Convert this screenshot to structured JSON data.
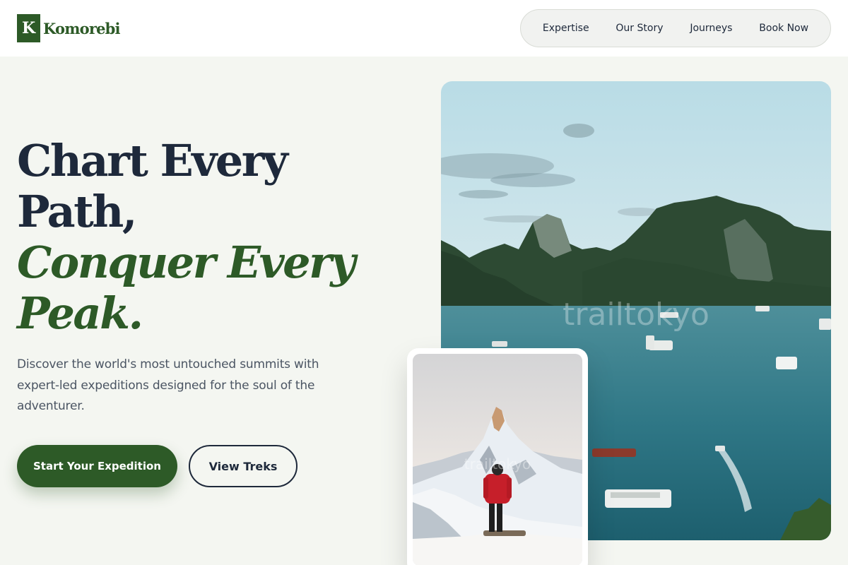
{
  "brand": {
    "mark": "K",
    "name": "Komorebi",
    "color": "#2d5a27"
  },
  "nav": {
    "items": [
      {
        "label": "Expertise"
      },
      {
        "label": "Our Story"
      },
      {
        "label": "Journeys"
      },
      {
        "label": "Book Now"
      }
    ]
  },
  "hero": {
    "title_line1": "Chart Every",
    "title_line2": "Path,",
    "title_line3": "Conquer Every",
    "title_line4": "Peak.",
    "description": "Discover the world's most untouched summits with expert-led expeditions designed for the soul of the adventurer.",
    "primary_button": "Start Your Expedition",
    "secondary_button": "View Treks"
  },
  "images": {
    "main_watermark": "trailtokyo",
    "small_watermark": "trailtokyo"
  },
  "colors": {
    "accent": "#2d5a27",
    "text": "#1e293b",
    "background": "#f4f6f1"
  }
}
